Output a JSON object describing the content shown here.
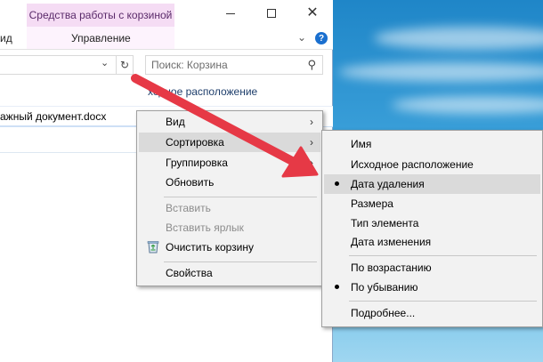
{
  "window": {
    "context_tab_header": "Средства работы с корзиной",
    "ribbon_tabs": {
      "view_partial": "ид",
      "manage": "Управление"
    },
    "help": "?",
    "close_glyph": "✕"
  },
  "search": {
    "placeholder": "Поиск: Корзина"
  },
  "columns": {
    "original_location_partial": "ходное расположение"
  },
  "files": [
    {
      "name_partial": "ажный документ.docx"
    }
  ],
  "context_menu": {
    "items": [
      {
        "label": "Вид",
        "submenu": true
      },
      {
        "label": "Сортировка",
        "submenu": true,
        "highlighted": true
      },
      {
        "label": "Группировка",
        "submenu": true
      },
      {
        "label": "Обновить"
      },
      {
        "label": "Вставить",
        "disabled": true
      },
      {
        "label": "Вставить ярлык",
        "disabled": true
      },
      {
        "label": "Очистить корзину",
        "icon": "recycle-bin-icon"
      },
      {
        "label": "Свойства"
      }
    ]
  },
  "sort_submenu": {
    "items": [
      {
        "label": "Имя"
      },
      {
        "label": "Исходное расположение"
      },
      {
        "label": "Дата удаления",
        "checked": true,
        "highlighted": true
      },
      {
        "label": "Размера"
      },
      {
        "label": "Тип элемента"
      },
      {
        "label": "Дата изменения"
      },
      {
        "label": "По возрастанию"
      },
      {
        "label": "По убыванию",
        "checked": true
      },
      {
        "label": "Подробнее..."
      }
    ]
  },
  "colors": {
    "context_tab": "#f5dcf4",
    "arrow": "#e63946",
    "menu_bg": "#f2f2f2",
    "menu_hover": "#dadada"
  }
}
